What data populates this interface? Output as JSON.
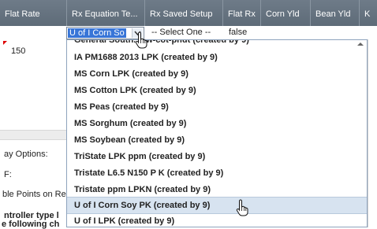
{
  "headers": [
    "Flat Rate",
    "Rx Equation Te...",
    "Rx Saved Setup",
    "Flat Rx",
    "Corn Yld",
    "Bean Yld",
    "K"
  ],
  "row1": {
    "flat_rate": "150",
    "rx_equation_selected": "U of I Corn So",
    "rx_saved_setup": "-- Select One --",
    "flat_rx": "false"
  },
  "left_labels": [
    "ay Options:",
    "F:",
    "ble Points on Re",
    "ntroller type l",
    "e following ch"
  ],
  "dropdown": {
    "partial_top": "General South... -w-cot-pnut (created by 9)",
    "items": [
      "IA PM1688 2013 LPK (created by 9)",
      "MS Corn LPK (created by 9)",
      "MS Cotton LPK (created by 9)",
      "MS Peas (created by 9)",
      "MS Sorghum (created by 9)",
      "MS Soybean (created by 9)",
      "TriState LPK ppm (created by 9)",
      "Tristate L6.5 N150 P K (created by 9)",
      "Tristate ppm LPKN (created by 9)",
      "U of I Corn Soy PK (created by 9)",
      "U of I LPK (created by 9)"
    ],
    "selected_index": 9
  },
  "colors": {
    "header_bg": "#66737f",
    "highlight": "#3875d7",
    "selected_row": "#d7e3f0"
  },
  "icons": [
    "chevron-down-icon",
    "hand-pointer-icon",
    "scroll-up-icon"
  ]
}
